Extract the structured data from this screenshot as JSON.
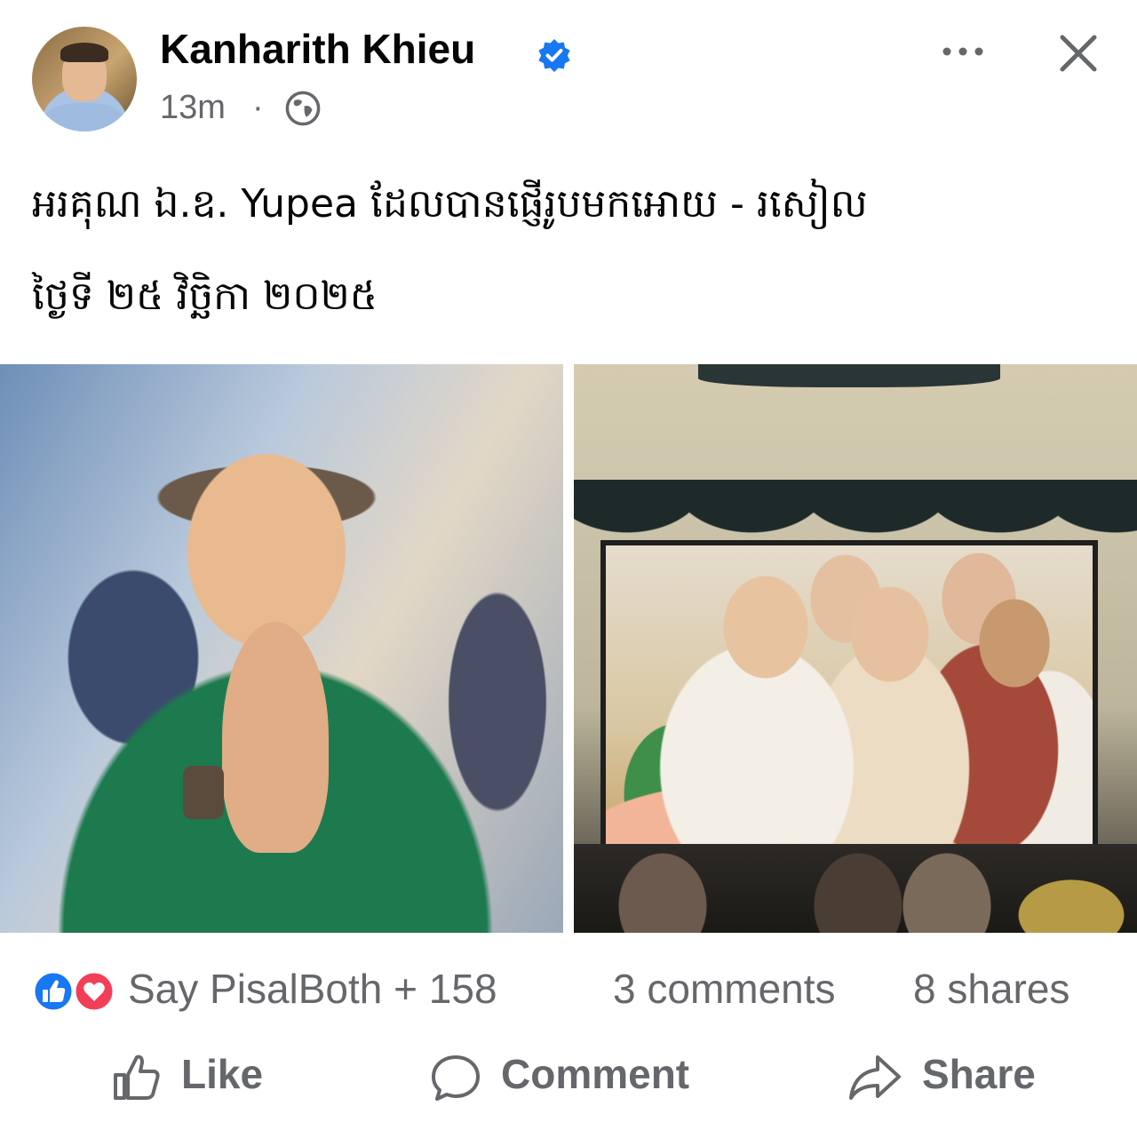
{
  "post": {
    "author": "Kanharith Khieu",
    "time": "13m",
    "separator": "·",
    "caption_line1": "អរគុណ ឯ.ឧ. Yupea ដែលបានផ្ញើរូបមកអោយ - រសៀល",
    "caption_line2": "ថ្ងៃទី ២៥ វិច្ឆិកា ២០២៥"
  },
  "stats": {
    "reactions": "Say PisalBoth + 158",
    "comments": "3 comments",
    "shares": "8 shares"
  },
  "actions": {
    "like": "Like",
    "comment": "Comment",
    "share": "Share"
  },
  "icons": {
    "verified": "verified-badge-icon",
    "audience": "globe-icon",
    "more": "more-dots-icon",
    "close": "close-icon",
    "like_reaction": "like-reaction-icon",
    "love_reaction": "love-reaction-icon"
  },
  "colors": {
    "verified_blue": "#1877f2",
    "love_red": "#f33e58",
    "secondary_text": "#65676b"
  }
}
